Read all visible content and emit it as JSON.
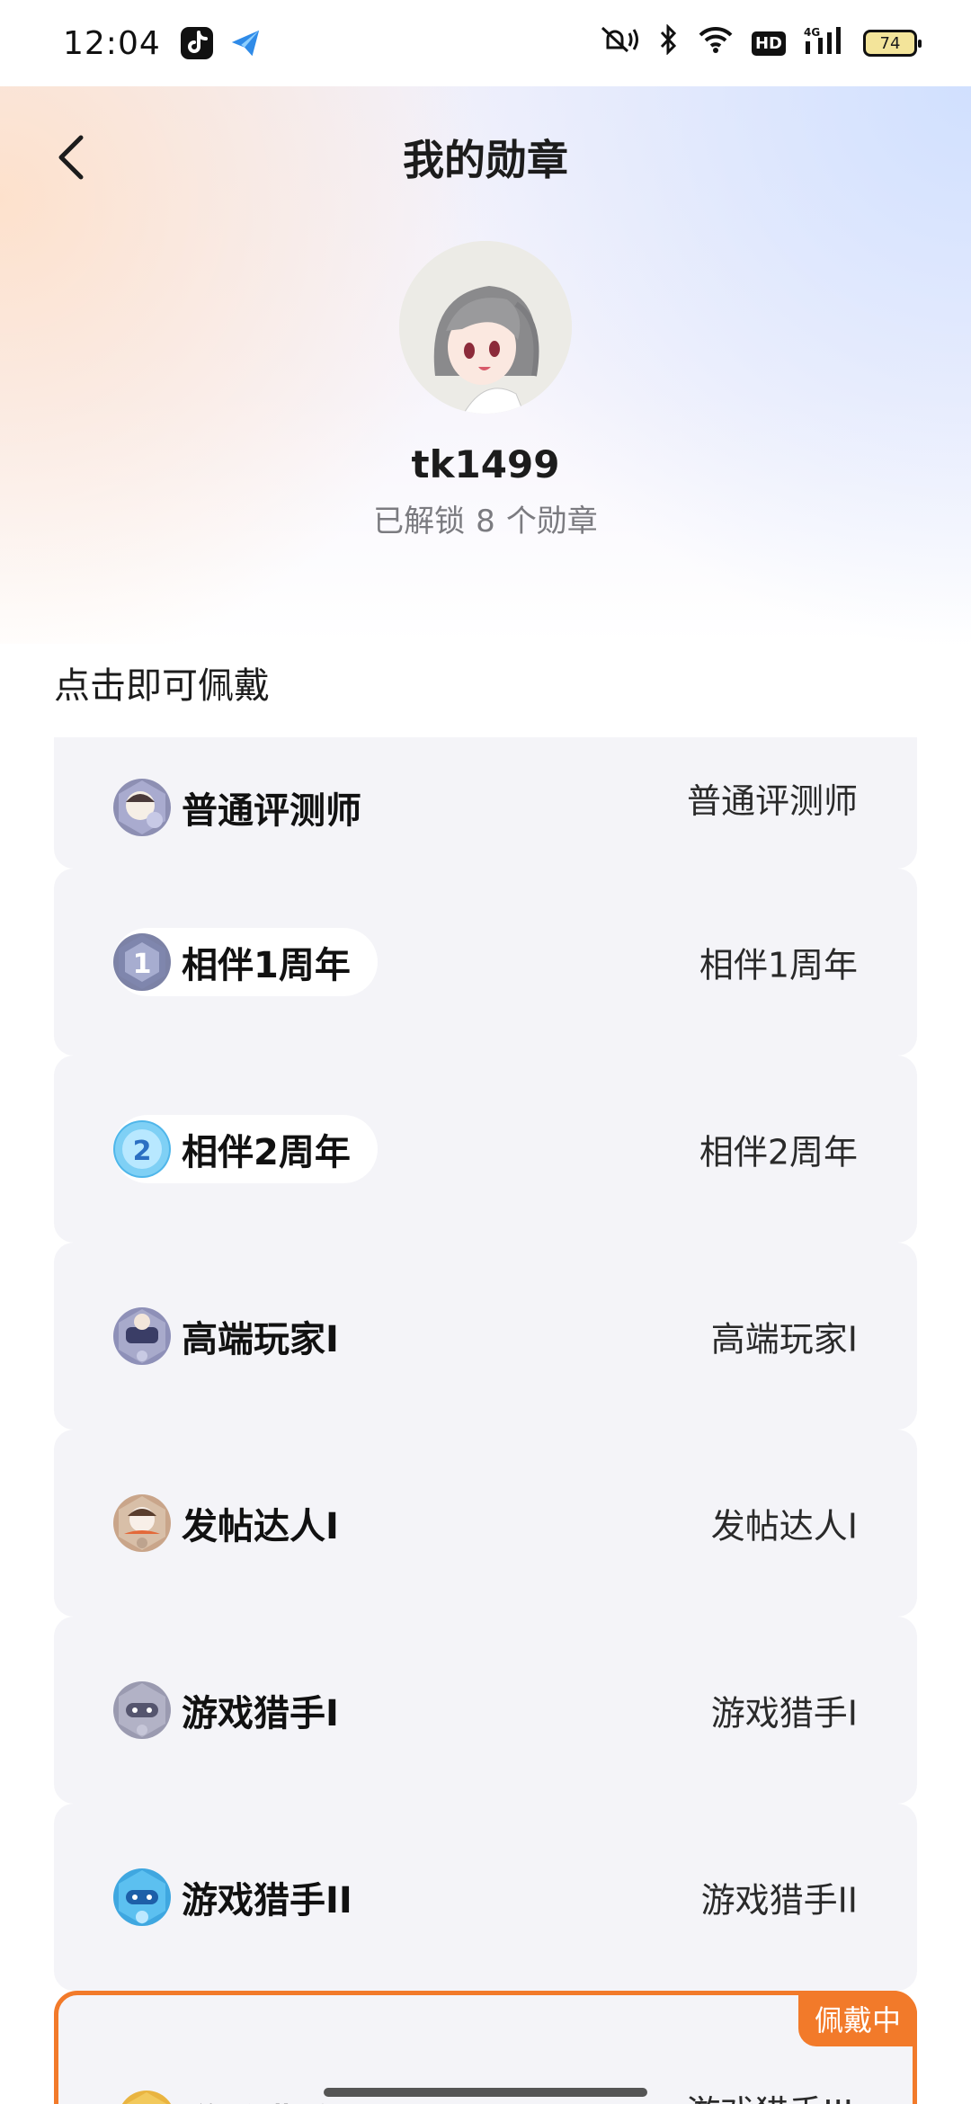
{
  "status_bar": {
    "time": "12:04",
    "app_icons": [
      "tiktok-icon",
      "paper-plane-icon"
    ],
    "icons": [
      "mute-icon",
      "bluetooth-icon",
      "wifi-icon",
      "hd-icon",
      "signal-icon"
    ],
    "hd_label": "HD",
    "network_label": "4G",
    "battery_level": "74"
  },
  "header": {
    "title": "我的勋章",
    "back_icon": "chevron-left-icon"
  },
  "profile": {
    "username": "tk1499",
    "unlock_prefix": "已解锁",
    "unlock_count": "8",
    "unlock_suffix": "个勋章"
  },
  "section": {
    "title": "点击即可佩戴"
  },
  "badges": [
    {
      "name": "普通评测师",
      "value": "普通评测师",
      "pill": false,
      "icon": "reviewer-badge-icon",
      "color": "#8d8fb3"
    },
    {
      "name": "相伴1周年",
      "value": "相伴1周年",
      "pill": true,
      "icon": "anniversary-1-badge-icon",
      "color": "#7c82a6",
      "digit": "1"
    },
    {
      "name": "相伴2周年",
      "value": "相伴2周年",
      "pill": true,
      "icon": "anniversary-2-badge-icon",
      "color": "#4fb6ea",
      "digit": "2"
    },
    {
      "name": "高端玩家I",
      "value": "高端玩家I",
      "pill": false,
      "icon": "pro-player-badge-icon",
      "color": "#8e90b8"
    },
    {
      "name": "发帖达人I",
      "value": "发帖达人I",
      "pill": false,
      "icon": "poster-badge-icon",
      "color": "#c9a58a"
    },
    {
      "name": "游戏猎手I",
      "value": "游戏猎手I",
      "pill": false,
      "icon": "game-hunter-1-badge-icon",
      "color": "#9a9ab0"
    },
    {
      "name": "游戏猎手II",
      "value": "游戏猎手II",
      "pill": false,
      "icon": "game-hunter-2-badge-icon",
      "color": "#3fa7e0"
    },
    {
      "name": "游戏猎手III",
      "value": "游戏猎手III",
      "pill": false,
      "icon": "game-hunter-3-badge-icon",
      "color": "#e9b440",
      "active": true
    }
  ],
  "wearing_label": "佩戴中",
  "colors": {
    "accent": "#f27a2a",
    "card_bg": "#f4f4f8",
    "muted_text": "#7b7b80"
  }
}
